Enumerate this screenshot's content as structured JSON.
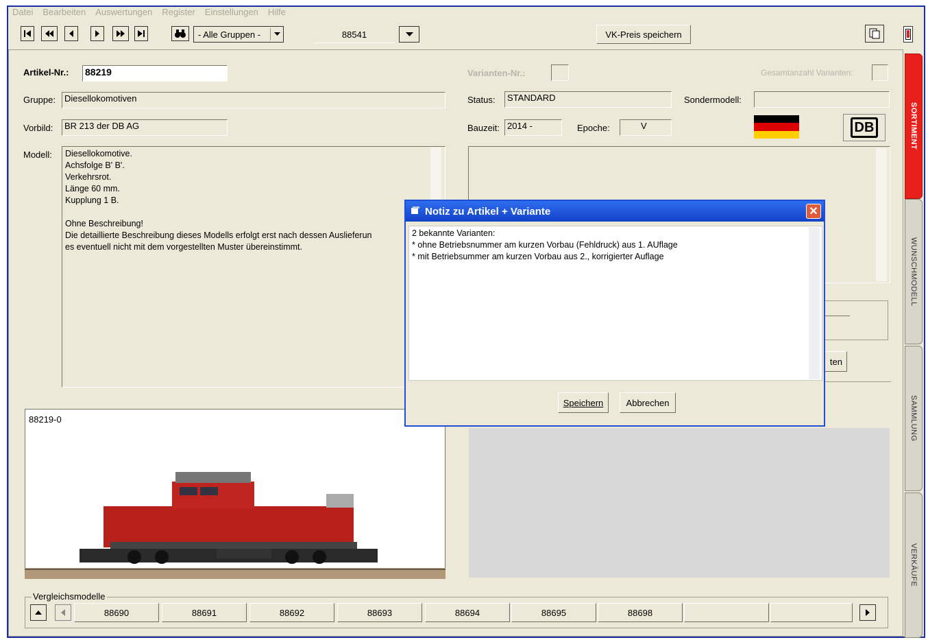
{
  "menu": [
    "Datei",
    "Bearbeiten",
    "Auswertungen",
    "Register",
    "Einstellungen",
    "Hilfe"
  ],
  "toolbar": {
    "group_select": "- Alle Gruppen -",
    "article_number": "88541",
    "save_price_button": "VK-Preis speichern"
  },
  "form": {
    "artikel_label": "Artikel-Nr.:",
    "artikel_value": "88219",
    "gruppe_label": "Gruppe:",
    "gruppe_value": "Diesellokomotiven",
    "vorbild_label": "Vorbild:",
    "vorbild_value": "BR 213 der DB AG",
    "modell_label": "Modell:",
    "modell_text": "Diesellokomotive.\nAchsfolge B' B'.\nVerkehrsrot.\nLänge 60 mm.\nKupplung 1 B.\n\nOhne Beschreibung!\nDie detaillierte Beschreibung dieses Modells erfolgt erst nach dessen Auslieferun\nes eventuell nicht mit dem vorgestellten Muster übereinstimmt.",
    "varianten_label": "Varianten-Nr.:",
    "gesamt_label": "Gesamtanzahl Varianten:",
    "status_label": "Status:",
    "status_value": "STANDARD",
    "sondermodell_label": "Sondermodell:",
    "bauzeit_label": "Bauzeit:",
    "bauzeit_value": "2014 -",
    "epoche_label": "Epoche:",
    "epoche_value": "V",
    "db_logo": "DB"
  },
  "image_caption": "88219-0",
  "side_tabs": [
    "SORTIMENT",
    "WUNSCHMODELL",
    "SAMMLUNG",
    "VERKÄUFE"
  ],
  "partial_texts": {
    "right_button": "ten"
  },
  "dialog": {
    "title": "Notiz zu Artikel + Variante",
    "text": "2 bekannte Varianten:\n* ohne Betriebsnummer am kurzen Vorbau (Fehldruck) aus 1. AUflage\n* mit Betriebsummer am kurzen Vorbau aus 2., korrigierter Auflage",
    "save_button": "Speichern",
    "cancel_button": "Abbrechen"
  },
  "vergleich": {
    "label": "Vergleichsmodelle",
    "items": [
      "88690",
      "88691",
      "88692",
      "88693",
      "88694",
      "88695",
      "88698",
      "",
      ""
    ]
  },
  "colors": {
    "frame_border": "#1c2fa0",
    "window_bg": "#ece9d8",
    "sortiment_tab": "#e8201c",
    "dialog_title": "#1f4fd6"
  }
}
